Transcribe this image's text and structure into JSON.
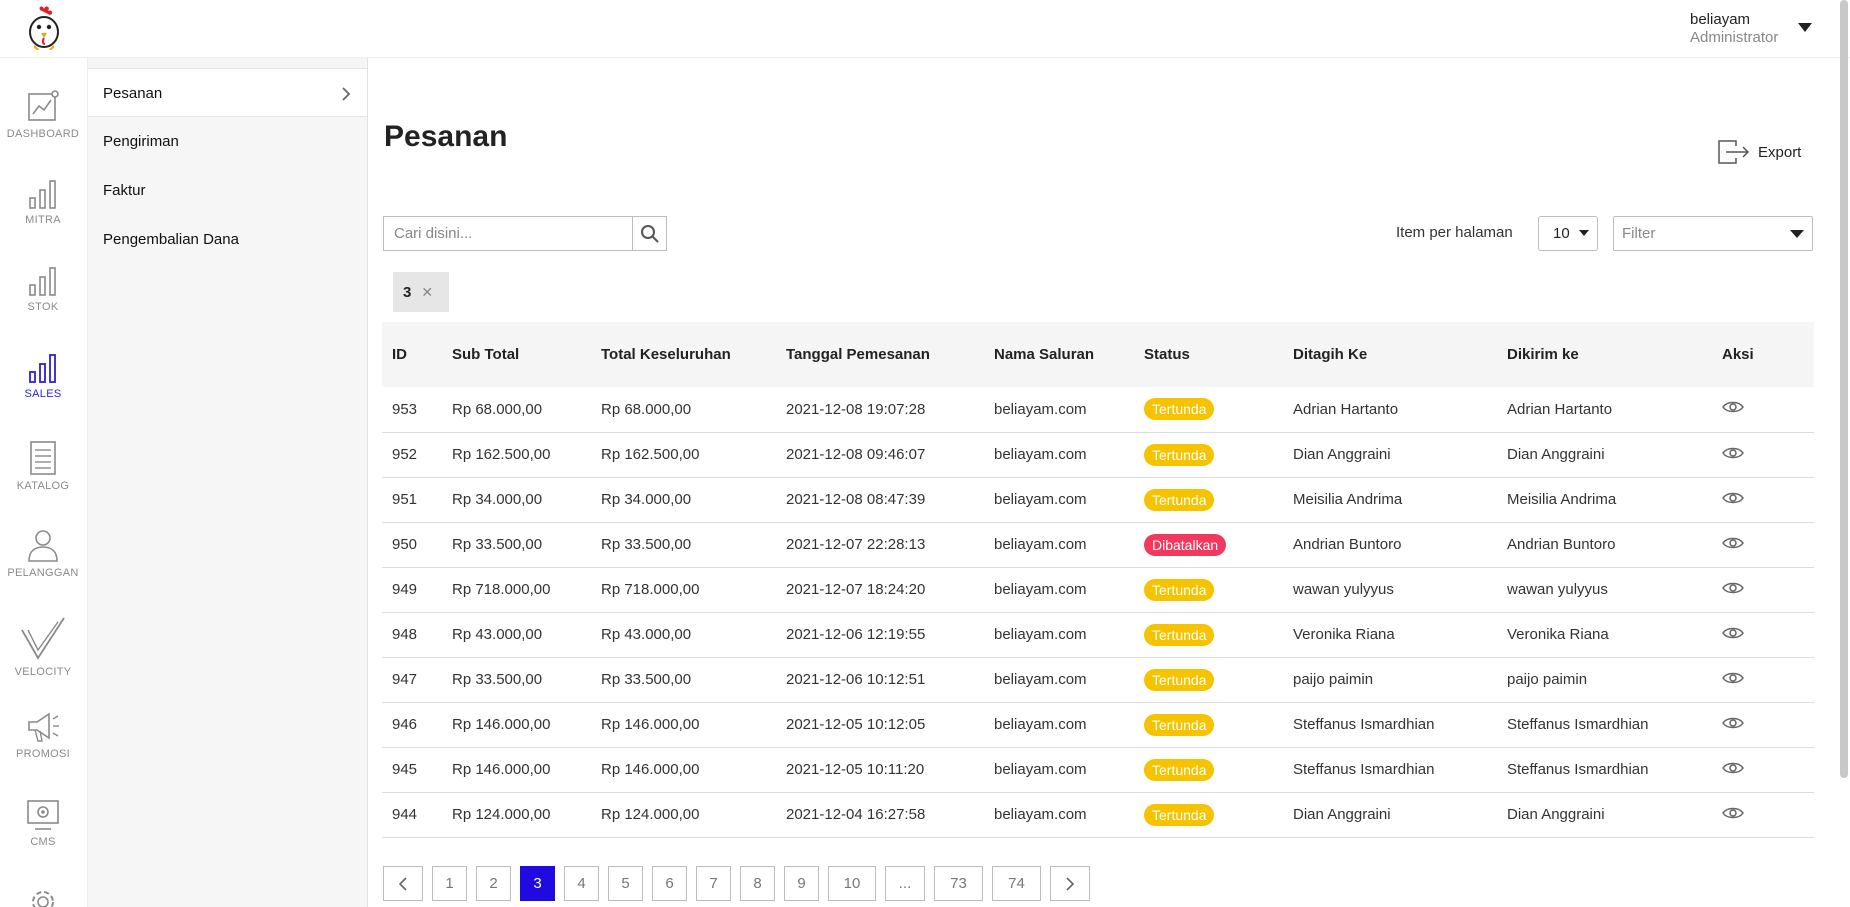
{
  "header": {
    "user_name": "beliayam",
    "user_role": "Administrator"
  },
  "rail": {
    "items": [
      {
        "label": "DASHBOARD",
        "icon": "dashboard-chart-icon"
      },
      {
        "label": "MITRA",
        "icon": "bar-chart-icon"
      },
      {
        "label": "STOK",
        "icon": "bar-chart-icon"
      },
      {
        "label": "SALES",
        "icon": "bar-chart-icon",
        "active": true
      },
      {
        "label": "KATALOG",
        "icon": "document-icon"
      },
      {
        "label": "PELANGGAN",
        "icon": "user-icon"
      },
      {
        "label": "VELOCITY",
        "icon": "check-icon"
      },
      {
        "label": "PROMOSI",
        "icon": "megaphone-icon"
      },
      {
        "label": "CMS",
        "icon": "monitor-gear-icon"
      },
      {
        "label": "",
        "icon": "gear-icon"
      }
    ]
  },
  "submenu": {
    "items": [
      {
        "label": "Pesanan",
        "active": true
      },
      {
        "label": "Pengiriman"
      },
      {
        "label": "Faktur"
      },
      {
        "label": "Pengembalian Dana"
      }
    ]
  },
  "page": {
    "title": "Pesanan",
    "export_label": "Export",
    "search_placeholder": "Cari disini...",
    "items_per_page_label": "Item per halaman",
    "items_per_page_value": "10",
    "filter_placeholder": "Filter",
    "active_chip": "3"
  },
  "table": {
    "columns": [
      "ID",
      "Sub Total",
      "Total Keseluruhan",
      "Tanggal Pemesanan",
      "Nama Saluran",
      "Status",
      "Ditagih Ke",
      "Dikirim ke",
      "Aksi"
    ],
    "rows": [
      {
        "id": "953",
        "subtotal": "Rp 68.000,00",
        "total": "Rp 68.000,00",
        "date": "2021-12-08 19:07:28",
        "channel": "beliayam.com",
        "status": "Tertunda",
        "status_type": "pending",
        "billed": "Adrian Hartanto",
        "shipped": "Adrian Hartanto"
      },
      {
        "id": "952",
        "subtotal": "Rp 162.500,00",
        "total": "Rp 162.500,00",
        "date": "2021-12-08 09:46:07",
        "channel": "beliayam.com",
        "status": "Tertunda",
        "status_type": "pending",
        "billed": "Dian Anggraini",
        "shipped": "Dian Anggraini"
      },
      {
        "id": "951",
        "subtotal": "Rp 34.000,00",
        "total": "Rp 34.000,00",
        "date": "2021-12-08 08:47:39",
        "channel": "beliayam.com",
        "status": "Tertunda",
        "status_type": "pending",
        "billed": "Meisilia Andrima",
        "shipped": "Meisilia Andrima"
      },
      {
        "id": "950",
        "subtotal": "Rp 33.500,00",
        "total": "Rp 33.500,00",
        "date": "2021-12-07 22:28:13",
        "channel": "beliayam.com",
        "status": "Dibatalkan",
        "status_type": "cancel",
        "billed": "Andrian Buntoro",
        "shipped": "Andrian Buntoro"
      },
      {
        "id": "949",
        "subtotal": "Rp 718.000,00",
        "total": "Rp 718.000,00",
        "date": "2021-12-07 18:24:20",
        "channel": "beliayam.com",
        "status": "Tertunda",
        "status_type": "pending",
        "billed": "wawan yulyyus",
        "shipped": "wawan yulyyus"
      },
      {
        "id": "948",
        "subtotal": "Rp 43.000,00",
        "total": "Rp 43.000,00",
        "date": "2021-12-06 12:19:55",
        "channel": "beliayam.com",
        "status": "Tertunda",
        "status_type": "pending",
        "billed": "Veronika Riana",
        "shipped": "Veronika Riana"
      },
      {
        "id": "947",
        "subtotal": "Rp 33.500,00",
        "total": "Rp 33.500,00",
        "date": "2021-12-06 10:12:51",
        "channel": "beliayam.com",
        "status": "Tertunda",
        "status_type": "pending",
        "billed": "paijo paimin",
        "shipped": "paijo paimin"
      },
      {
        "id": "946",
        "subtotal": "Rp 146.000,00",
        "total": "Rp 146.000,00",
        "date": "2021-12-05 10:12:05",
        "channel": "beliayam.com",
        "status": "Tertunda",
        "status_type": "pending",
        "billed": "Steffanus Ismardhian",
        "shipped": "Steffanus Ismardhian"
      },
      {
        "id": "945",
        "subtotal": "Rp 146.000,00",
        "total": "Rp 146.000,00",
        "date": "2021-12-05 10:11:20",
        "channel": "beliayam.com",
        "status": "Tertunda",
        "status_type": "pending",
        "billed": "Steffanus Ismardhian",
        "shipped": "Steffanus Ismardhian"
      },
      {
        "id": "944",
        "subtotal": "Rp 124.000,00",
        "total": "Rp 124.000,00",
        "date": "2021-12-04 16:27:58",
        "channel": "beliayam.com",
        "status": "Tertunda",
        "status_type": "pending",
        "billed": "Dian Anggraini",
        "shipped": "Dian Anggraini"
      }
    ]
  },
  "pagination": {
    "pages": [
      "1",
      "2",
      "3",
      "4",
      "5",
      "6",
      "7",
      "8",
      "9",
      "10",
      "...",
      "73",
      "74"
    ],
    "current": "3"
  },
  "colors": {
    "accent": "#1f0be0",
    "pending": "#f6c300",
    "cancel": "#f2395d"
  }
}
